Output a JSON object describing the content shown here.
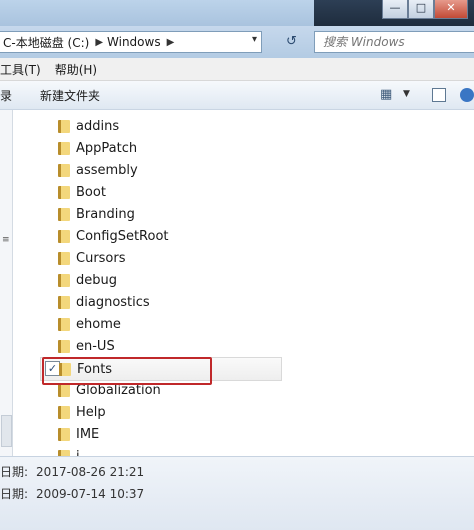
{
  "window": {
    "minimize_label": "—",
    "maximize_label": "□"
  },
  "address": {
    "path_drive": "C-本地磁盘 (C:)",
    "path_folder": "Windows",
    "separator": "▶",
    "dropdown": "▾",
    "refresh": "↺"
  },
  "search": {
    "placeholder": "搜索 Windows"
  },
  "menu": {
    "tools": "工具(T)",
    "help": "帮助(H)"
  },
  "toolbar": {
    "record_label": "录",
    "new_folder_label": "新建文件夹",
    "view_glyph": "▦",
    "view_dd": "▼"
  },
  "folders": [
    {
      "name": "addins"
    },
    {
      "name": "AppPatch"
    },
    {
      "name": "assembly"
    },
    {
      "name": "Boot"
    },
    {
      "name": "Branding"
    },
    {
      "name": "ConfigSetRoot"
    },
    {
      "name": "Cursors"
    },
    {
      "name": "debug"
    },
    {
      "name": "diagnostics"
    },
    {
      "name": "ehome"
    },
    {
      "name": "en-US"
    },
    {
      "name": "Fonts",
      "selected": true
    },
    {
      "name": "Globalization"
    },
    {
      "name": "Help"
    },
    {
      "name": "IME"
    },
    {
      "name": "i..."
    }
  ],
  "selected_check": "✓",
  "details": {
    "modified_label": "日期:",
    "modified_value": "2017-08-26 21:21",
    "created_label": "日期:",
    "created_value": "2009-07-14 10:37"
  },
  "colors": {
    "highlight": "#c0282a",
    "folder": "#f3d77c"
  }
}
